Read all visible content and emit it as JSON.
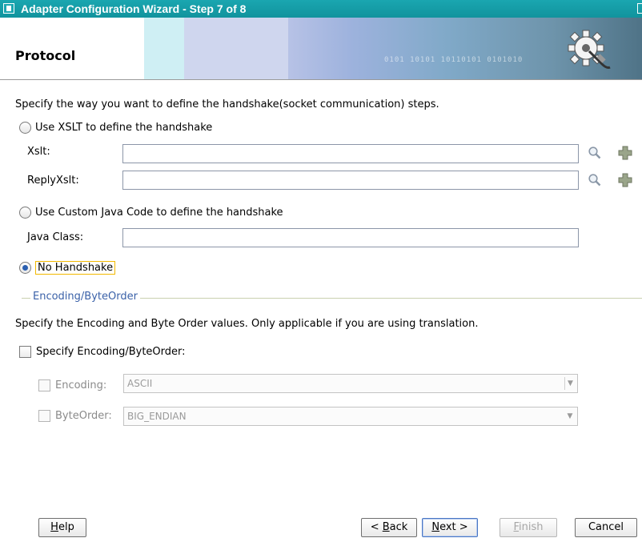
{
  "window": {
    "title": "Adapter Configuration Wizard - Step 7 of 8"
  },
  "header": {
    "page_title": "Protocol",
    "binary_text": "0101 10101 10110101 0101010"
  },
  "intro_text": "Specify the way you want to define the handshake(socket communication) steps.",
  "options": {
    "xslt": {
      "label": "Use XSLT to define the handshake",
      "selected": false,
      "xslt_label": "Xslt:",
      "xslt_value": "",
      "reply_label": "ReplyXslt:",
      "reply_value": ""
    },
    "java": {
      "label": "Use Custom Java Code to define the handshake",
      "selected": false,
      "class_label": "Java Class:",
      "class_value": ""
    },
    "none": {
      "label": "No Handshake",
      "selected": true
    }
  },
  "encoding_section": {
    "title": "Encoding/ByteOrder",
    "description": "Specify the Encoding and Byte Order values. Only applicable if you are using translation.",
    "specify_label": "Specify Encoding/ByteOrder:",
    "specify_checked": false,
    "encoding_label": "Encoding:",
    "encoding_value": "ASCII",
    "byteorder_label": "ByteOrder:",
    "byteorder_value": "BIG_ENDIAN"
  },
  "buttons": {
    "help": {
      "mnemonic": "H",
      "rest": "elp"
    },
    "back": {
      "prefix": "< ",
      "mnemonic": "B",
      "rest": "ack"
    },
    "next": {
      "mnemonic": "N",
      "rest": "ext >"
    },
    "finish": {
      "mnemonic": "F",
      "rest": "inish"
    },
    "cancel": {
      "label": "Cancel"
    }
  },
  "icons": {
    "browse": "search-icon",
    "add": "plus-icon",
    "dropdown": "chevron-down-icon"
  },
  "colors": {
    "titlebar": "#1aa6b0",
    "section_title": "#3a61a8",
    "focus_border": "#f2b900"
  }
}
